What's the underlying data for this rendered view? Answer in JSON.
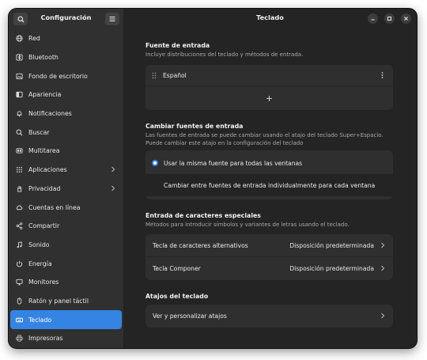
{
  "sidebar": {
    "title": "Configuración",
    "items": [
      {
        "label": "Red",
        "icon": "globe-icon"
      },
      {
        "label": "Bluetooth",
        "icon": "bluetooth-icon"
      },
      {
        "label": "Fondo de escritorio",
        "icon": "wallpaper-icon"
      },
      {
        "label": "Apariencia",
        "icon": "appearance-icon"
      },
      {
        "label": "Notificaciones",
        "icon": "bell-icon"
      },
      {
        "label": "Buscar",
        "icon": "search-icon"
      },
      {
        "label": "Multitarea",
        "icon": "multitasking-icon"
      },
      {
        "label": "Aplicaciones",
        "icon": "apps-grid-icon"
      },
      {
        "label": "Privacidad",
        "icon": "hand-icon"
      },
      {
        "label": "Cuentas en línea",
        "icon": "cloud-icon"
      },
      {
        "label": "Compartir",
        "icon": "share-icon"
      },
      {
        "label": "Sonido",
        "icon": "music-note-icon"
      },
      {
        "label": "Energía",
        "icon": "power-icon"
      },
      {
        "label": "Monitores",
        "icon": "monitor-icon"
      },
      {
        "label": "Ratón y panel táctil",
        "icon": "mouse-icon"
      },
      {
        "label": "Teclado",
        "icon": "keyboard-icon"
      },
      {
        "label": "Impresoras",
        "icon": "printer-icon"
      }
    ],
    "active_index": 15
  },
  "header": {
    "title": "Teclado"
  },
  "input_sources": {
    "title": "Fuente de entrada",
    "description": "Incluye distribuciones del teclado y métodos de entrada.",
    "sources": [
      "Español"
    ],
    "add_symbol": "+"
  },
  "switch_sources": {
    "title": "Cambiar fuentes de entrada",
    "description_line1": "Las fuentes de entrada se puede cambiar usando el atajo del teclado Super+Espacio.",
    "description_line2": "Puede cambiar este atajo en la configuración del teclado",
    "options": [
      {
        "label": "Usar la misma fuente para todas las ventanas",
        "selected": true
      },
      {
        "label": "Cambiar entre fuentes de entrada individualmente para cada ventana",
        "selected": false
      }
    ]
  },
  "special_chars": {
    "title": "Entrada de caracteres especiales",
    "description": "Métodos para introducir símbolos y variantes de letras usando el teclado.",
    "rows": [
      {
        "label": "Tecla de caracteres alternativos",
        "value": "Disposición predeterminada"
      },
      {
        "label": "Tecla Componer",
        "value": "Disposición predeterminada"
      }
    ]
  },
  "shortcuts": {
    "title": "Atajos del teclado",
    "row_label": "Ver y personalizar atajos"
  },
  "colors": {
    "accent": "#3584e4",
    "window_bg": "#242424",
    "sidebar_bg": "#303030",
    "card_bg": "#2f2f2f"
  }
}
